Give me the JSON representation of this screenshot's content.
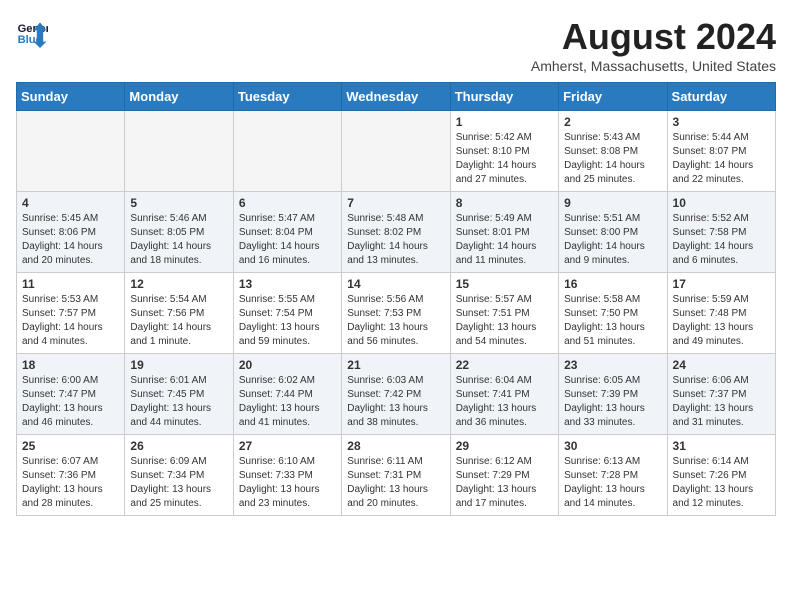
{
  "header": {
    "logo_line1": "General",
    "logo_line2": "Blue",
    "month_title": "August 2024",
    "location": "Amherst, Massachusetts, United States"
  },
  "weekdays": [
    "Sunday",
    "Monday",
    "Tuesday",
    "Wednesday",
    "Thursday",
    "Friday",
    "Saturday"
  ],
  "rows": [
    {
      "cells": [
        {
          "empty": true
        },
        {
          "empty": true
        },
        {
          "empty": true
        },
        {
          "empty": true
        },
        {
          "day": 1,
          "detail": "Sunrise: 5:42 AM\nSunset: 8:10 PM\nDaylight: 14 hours\nand 27 minutes."
        },
        {
          "day": 2,
          "detail": "Sunrise: 5:43 AM\nSunset: 8:08 PM\nDaylight: 14 hours\nand 25 minutes."
        },
        {
          "day": 3,
          "detail": "Sunrise: 5:44 AM\nSunset: 8:07 PM\nDaylight: 14 hours\nand 22 minutes."
        }
      ]
    },
    {
      "cells": [
        {
          "day": 4,
          "detail": "Sunrise: 5:45 AM\nSunset: 8:06 PM\nDaylight: 14 hours\nand 20 minutes."
        },
        {
          "day": 5,
          "detail": "Sunrise: 5:46 AM\nSunset: 8:05 PM\nDaylight: 14 hours\nand 18 minutes."
        },
        {
          "day": 6,
          "detail": "Sunrise: 5:47 AM\nSunset: 8:04 PM\nDaylight: 14 hours\nand 16 minutes."
        },
        {
          "day": 7,
          "detail": "Sunrise: 5:48 AM\nSunset: 8:02 PM\nDaylight: 14 hours\nand 13 minutes."
        },
        {
          "day": 8,
          "detail": "Sunrise: 5:49 AM\nSunset: 8:01 PM\nDaylight: 14 hours\nand 11 minutes."
        },
        {
          "day": 9,
          "detail": "Sunrise: 5:51 AM\nSunset: 8:00 PM\nDaylight: 14 hours\nand 9 minutes."
        },
        {
          "day": 10,
          "detail": "Sunrise: 5:52 AM\nSunset: 7:58 PM\nDaylight: 14 hours\nand 6 minutes."
        }
      ]
    },
    {
      "cells": [
        {
          "day": 11,
          "detail": "Sunrise: 5:53 AM\nSunset: 7:57 PM\nDaylight: 14 hours\nand 4 minutes."
        },
        {
          "day": 12,
          "detail": "Sunrise: 5:54 AM\nSunset: 7:56 PM\nDaylight: 14 hours\nand 1 minute."
        },
        {
          "day": 13,
          "detail": "Sunrise: 5:55 AM\nSunset: 7:54 PM\nDaylight: 13 hours\nand 59 minutes."
        },
        {
          "day": 14,
          "detail": "Sunrise: 5:56 AM\nSunset: 7:53 PM\nDaylight: 13 hours\nand 56 minutes."
        },
        {
          "day": 15,
          "detail": "Sunrise: 5:57 AM\nSunset: 7:51 PM\nDaylight: 13 hours\nand 54 minutes."
        },
        {
          "day": 16,
          "detail": "Sunrise: 5:58 AM\nSunset: 7:50 PM\nDaylight: 13 hours\nand 51 minutes."
        },
        {
          "day": 17,
          "detail": "Sunrise: 5:59 AM\nSunset: 7:48 PM\nDaylight: 13 hours\nand 49 minutes."
        }
      ]
    },
    {
      "cells": [
        {
          "day": 18,
          "detail": "Sunrise: 6:00 AM\nSunset: 7:47 PM\nDaylight: 13 hours\nand 46 minutes."
        },
        {
          "day": 19,
          "detail": "Sunrise: 6:01 AM\nSunset: 7:45 PM\nDaylight: 13 hours\nand 44 minutes."
        },
        {
          "day": 20,
          "detail": "Sunrise: 6:02 AM\nSunset: 7:44 PM\nDaylight: 13 hours\nand 41 minutes."
        },
        {
          "day": 21,
          "detail": "Sunrise: 6:03 AM\nSunset: 7:42 PM\nDaylight: 13 hours\nand 38 minutes."
        },
        {
          "day": 22,
          "detail": "Sunrise: 6:04 AM\nSunset: 7:41 PM\nDaylight: 13 hours\nand 36 minutes."
        },
        {
          "day": 23,
          "detail": "Sunrise: 6:05 AM\nSunset: 7:39 PM\nDaylight: 13 hours\nand 33 minutes."
        },
        {
          "day": 24,
          "detail": "Sunrise: 6:06 AM\nSunset: 7:37 PM\nDaylight: 13 hours\nand 31 minutes."
        }
      ]
    },
    {
      "cells": [
        {
          "day": 25,
          "detail": "Sunrise: 6:07 AM\nSunset: 7:36 PM\nDaylight: 13 hours\nand 28 minutes."
        },
        {
          "day": 26,
          "detail": "Sunrise: 6:09 AM\nSunset: 7:34 PM\nDaylight: 13 hours\nand 25 minutes."
        },
        {
          "day": 27,
          "detail": "Sunrise: 6:10 AM\nSunset: 7:33 PM\nDaylight: 13 hours\nand 23 minutes."
        },
        {
          "day": 28,
          "detail": "Sunrise: 6:11 AM\nSunset: 7:31 PM\nDaylight: 13 hours\nand 20 minutes."
        },
        {
          "day": 29,
          "detail": "Sunrise: 6:12 AM\nSunset: 7:29 PM\nDaylight: 13 hours\nand 17 minutes."
        },
        {
          "day": 30,
          "detail": "Sunrise: 6:13 AM\nSunset: 7:28 PM\nDaylight: 13 hours\nand 14 minutes."
        },
        {
          "day": 31,
          "detail": "Sunrise: 6:14 AM\nSunset: 7:26 PM\nDaylight: 13 hours\nand 12 minutes."
        }
      ]
    }
  ]
}
